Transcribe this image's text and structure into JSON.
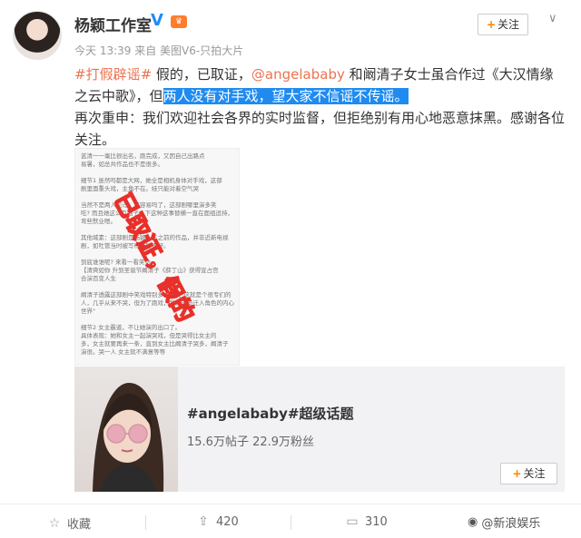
{
  "header": {
    "name": "杨颖工作室",
    "verify_badge": "V",
    "meta": "今天 13:39 来自 美图V6-只拍大片",
    "follow_label": "关注",
    "chevron": "∨"
  },
  "post": {
    "tag": "#打假辟谣#",
    "p1": " 假的，已取证，",
    "mention": "@angelababy",
    "p2": " 和阚清子女士虽合作过《大汉情缘之云中歌》，但",
    "highlight": "两人没有对手戏，望大家不信谣不传谣。",
    "p3": "再次重申：我们欢迎社会各界的实时监督，但拒绝别有用心地恶意抹黑。感谢各位关注。"
  },
  "photo": {
    "doc_lines": [
      "蓝清一一毫比很出名，跑完成，又因自己出路点",
      "易暑，如总共作品也不是很多。",
      "",
      "细节1 虽然吗都是大网，她全是相机身体对手戏，这部",
      "剧里面重头戏，主角不在。娃只能对着空气哭",
      "",
      "当然不是两人见过，不容易吗了，这部剧哪里演多笑",
      "吃? 而且她这么有脑子，下这种这事替横一直在面组逗持，",
      "弯些默业嗯。",
      "",
      "其他域素：这部剧是杨颖十年之前的作品，并非近新电视",
      "剧，如吐管当时被写得不够不好。",
      "",
      "到底谁谁呢? 来看一看笑访:",
      "【清爽如你 升到圣诞节阚清子《薛丁山》获得宣占宫",
      "合演百变人生",
      "",
      "阚清子透露这部剧中笑戏特别多，她说\"这就是个很专们的",
      "人，几乎从来不哭，但为了跑戏，我要动员迁入角色的内心",
      "世界\"",
      "",
      "细节2 女主霸道，不让她演的出口了。",
      "具体表现：她和女主一起演哭戏，但是哭得比女主的",
      "多，女主就要再来一条，直到女主比阚清子哭多，阚清子",
      "演很。哭一人 女主就不满意等等"
    ],
    "stamp_text": "已取证，假的"
  },
  "card": {
    "title": "#angelababy#超级话题",
    "subtitle": "15.6万帖子 22.9万粉丝",
    "follow_label": "关注"
  },
  "footer": {
    "favorite_label": "收藏",
    "repost_count": "420",
    "comment_count": "310",
    "watermark": "@新浪娱乐"
  },
  "colors": {
    "accent": "#eb7350",
    "highlight_bg": "#1f8bf0",
    "verify": "#1d8cf8",
    "follow_plus": "#ff8200",
    "stamp_red": "#e8302a"
  }
}
